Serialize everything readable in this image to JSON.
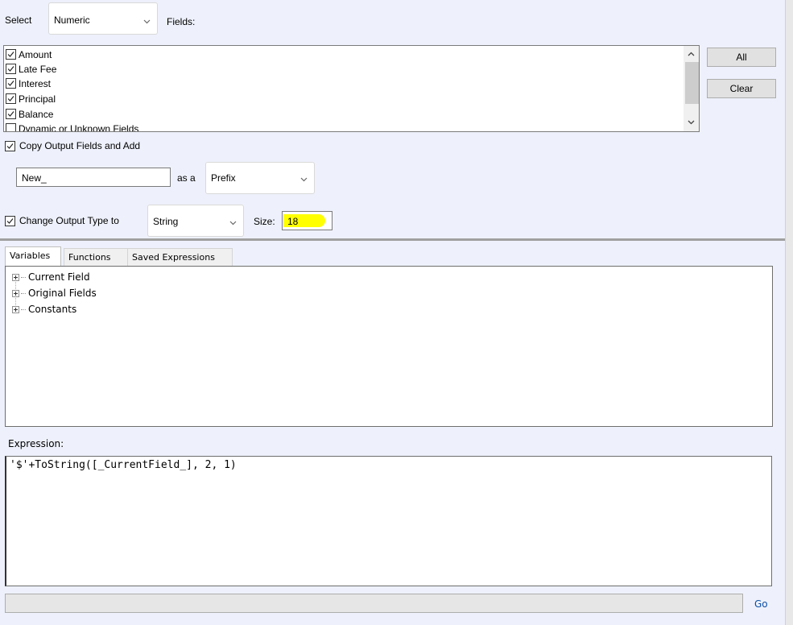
{
  "top": {
    "select_label": "Select",
    "select_value": "Numeric",
    "fields_label": "Fields:"
  },
  "fields": [
    {
      "label": "Amount",
      "checked": true
    },
    {
      "label": "Late Fee",
      "checked": true
    },
    {
      "label": "Interest",
      "checked": true
    },
    {
      "label": "Principal",
      "checked": true
    },
    {
      "label": "Balance",
      "checked": true
    },
    {
      "label": "Dynamic or Unknown Fields",
      "checked": false
    }
  ],
  "buttons": {
    "all": "All",
    "clear": "Clear"
  },
  "copy_output": {
    "label": "Copy Output Fields and Add",
    "checked": true,
    "prefix_value": "New_",
    "as_a_label": "as a",
    "position_value": "Prefix"
  },
  "change_type": {
    "label": "Change Output Type to",
    "checked": true,
    "type_value": "String",
    "size_label": "Size:",
    "size_value": "18",
    "highlight_color": "#ffff00"
  },
  "tabs": [
    {
      "label": "Variables",
      "active": true
    },
    {
      "label": "Functions",
      "active": false
    },
    {
      "label": "Saved Expressions",
      "active": false
    }
  ],
  "tree": [
    {
      "label": "Current Field"
    },
    {
      "label": "Original Fields"
    },
    {
      "label": "Constants"
    }
  ],
  "expression": {
    "label": "Expression:",
    "value": "'$'+ToString([_CurrentField_], 2, 1)"
  },
  "footer": {
    "go_label": "Go",
    "link_color": "#0b4fa8"
  }
}
